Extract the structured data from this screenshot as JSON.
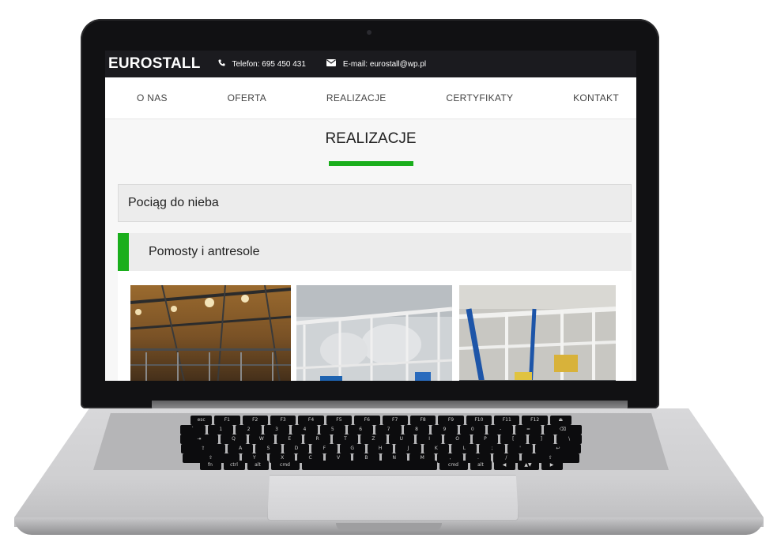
{
  "site": {
    "brand": "EUROSTALL",
    "phone": "Telefon: 695 450 431",
    "email": "E-mail: eurostall@wp.pl",
    "icons": [
      "phone-icon",
      "envelope-icon"
    ]
  },
  "nav": {
    "items": [
      "O NAS",
      "OFERTA",
      "REALIZACJE",
      "CERTYFIKATY",
      "KONTAKT"
    ]
  },
  "page": {
    "title": "REALIZACJE",
    "accent_color": "#1aae1c"
  },
  "accordion": [
    {
      "title": "Pociąg do nieba",
      "expanded": false
    },
    {
      "title": "Pomosty i antresole",
      "expanded": true,
      "photos": [
        "industrial-hall-ceiling-photo",
        "steel-platform-tanks-photo",
        "platform-structure-blue-columns-photo"
      ]
    }
  ],
  "keyboard": {
    "row1": [
      "esc",
      "F1",
      "F2",
      "F3",
      "F4",
      "F5",
      "F6",
      "F7",
      "F8",
      "F9",
      "F10",
      "F11",
      "F12",
      "⏏"
    ],
    "row2": [
      "`",
      "1",
      "2",
      "3",
      "4",
      "5",
      "6",
      "7",
      "8",
      "9",
      "0",
      "-",
      "=",
      "⌫"
    ],
    "row3": [
      "⇥",
      "Q",
      "W",
      "E",
      "R",
      "T",
      "Z",
      "U",
      "I",
      "O",
      "P",
      "[",
      "]",
      "\\"
    ],
    "row4": [
      "⇪",
      "A",
      "S",
      "D",
      "F",
      "G",
      "H",
      "J",
      "K",
      "L",
      ";",
      "'",
      "↩"
    ],
    "row5": [
      "⇧",
      "Y",
      "X",
      "C",
      "V",
      "B",
      "N",
      "M",
      ",",
      ".",
      "/",
      "⇧"
    ],
    "row6": [
      "fn",
      "ctrl",
      "alt",
      "cmd",
      "",
      "cmd",
      "alt",
      "◀",
      "▲▼",
      "▶"
    ]
  }
}
